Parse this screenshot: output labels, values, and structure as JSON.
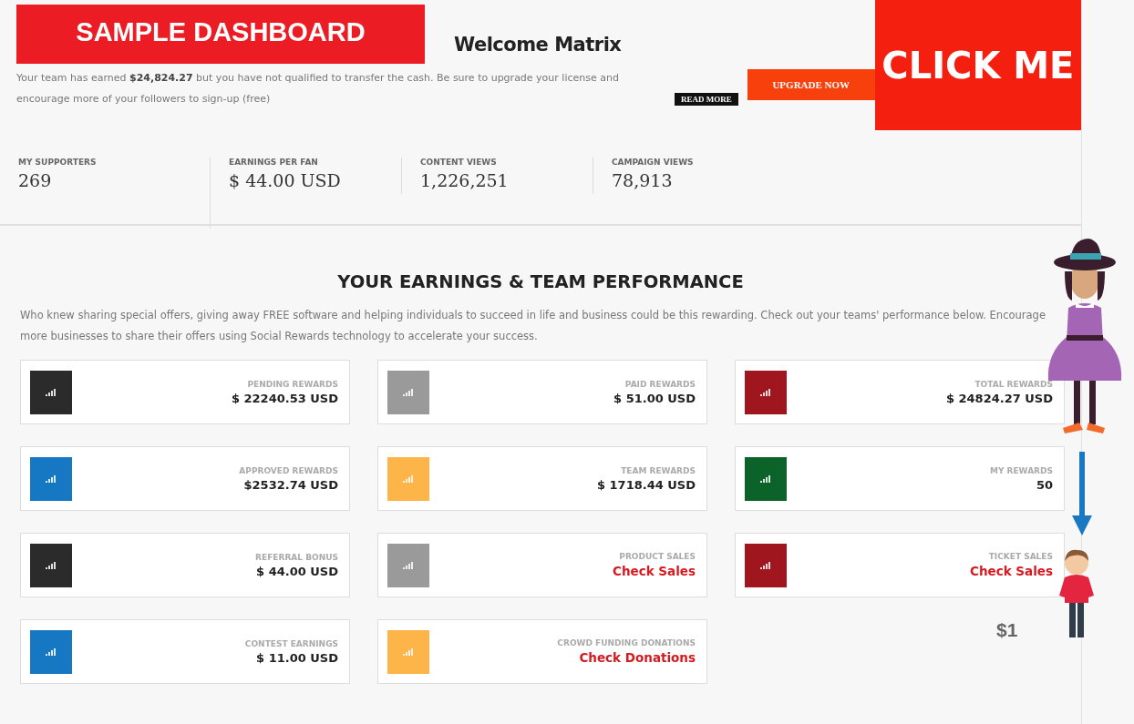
{
  "banner": {
    "title": "SAMPLE DASHBOARD"
  },
  "welcome": {
    "title": "Welcome Matrix",
    "message": "Your team has earned **$24,824.27** but you have not qualified to transfer the cash. Be sure to upgrade your license and encourage more of your followers to sign-up (free)",
    "read_more": "READ MORE",
    "upgrade": "UPGRADE NOW"
  },
  "promo": {
    "label": "CLICK ME"
  },
  "stats": [
    {
      "label": "MY SUPPORTERS",
      "value": "269"
    },
    {
      "label": "EARNINGS PER FAN",
      "value": "$ 44.00 USD"
    },
    {
      "label": "CONTENT VIEWS",
      "value": "1,226,251"
    },
    {
      "label": "CAMPAIGN VIEWS",
      "value": "78,913"
    }
  ],
  "section": {
    "title": "YOUR EARNINGS & TEAM PERFORMANCE",
    "description": "Who knew sharing special offers, giving away FREE software and helping individuals to succeed in life and business could be this rewarding. Check out your teams' performance below. Encourage more businesses to share their offers using Social Rewards technology to accelerate your success."
  },
  "cards": [
    {
      "label": "PENDING REWARDS",
      "value": "$ 22240.53 USD",
      "kind": "amount",
      "color": "#2b2b2b"
    },
    {
      "label": "PAID REWARDS",
      "value": "$ 51.00 USD",
      "kind": "amount",
      "color": "#9a9a9a"
    },
    {
      "label": "TOTAL REWARDS",
      "value": "$ 24824.27 USD",
      "kind": "amount",
      "color": "#a0161f"
    },
    {
      "label": "APPROVED REWARDS",
      "value": "$2532.74 USD",
      "kind": "amount",
      "color": "#1677c2"
    },
    {
      "label": "TEAM REWARDS",
      "value": "$ 1718.44 USD",
      "kind": "amount",
      "color": "#fdb54a"
    },
    {
      "label": "MY REWARDS",
      "value": "50",
      "kind": "amount",
      "color": "#0b6329"
    },
    {
      "label": "REFERRAL BONUS",
      "value": "$ 44.00 USD",
      "kind": "amount",
      "color": "#2b2b2b"
    },
    {
      "label": "PRODUCT SALES",
      "value": "Check Sales",
      "kind": "link",
      "color": "#9a9a9a"
    },
    {
      "label": "TICKET SALES",
      "value": "Check Sales",
      "kind": "link",
      "color": "#a0161f"
    },
    {
      "label": "CONTEST EARNINGS",
      "value": "$ 11.00 USD",
      "kind": "amount",
      "color": "#1677c2"
    },
    {
      "label": "CROWD FUNDING DONATIONS",
      "value": "Check Donations",
      "kind": "link",
      "color": "#fdb54a"
    }
  ],
  "overlay": {
    "price": "$1"
  }
}
